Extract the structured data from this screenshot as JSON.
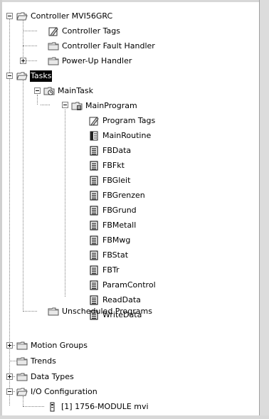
{
  "tree": {
    "controller": "Controller MVI56GRC",
    "controller_tags": "Controller Tags",
    "fault_handler": "Controller Fault Handler",
    "powerup_handler": "Power-Up Handler",
    "tasks": "Tasks",
    "main_task": "MainTask",
    "main_program": "MainProgram",
    "program_tags": "Program Tags",
    "main_routine": "MainRoutine",
    "routines": [
      "FBData",
      "FBFkt",
      "FBGleit",
      "FBGrenzen",
      "FBGrund",
      "FBMetall",
      "FBMwg",
      "FBStat",
      "FBTr",
      "ParamControl",
      "ReadData",
      "WriteData"
    ],
    "unscheduled": "Unscheduled Programs",
    "motion_groups": "Motion Groups",
    "trends": "Trends",
    "data_types": "Data Types",
    "io_config": "I/O Configuration",
    "io_module": "[1] 1756-MODULE mvi"
  },
  "selected": "Tasks"
}
